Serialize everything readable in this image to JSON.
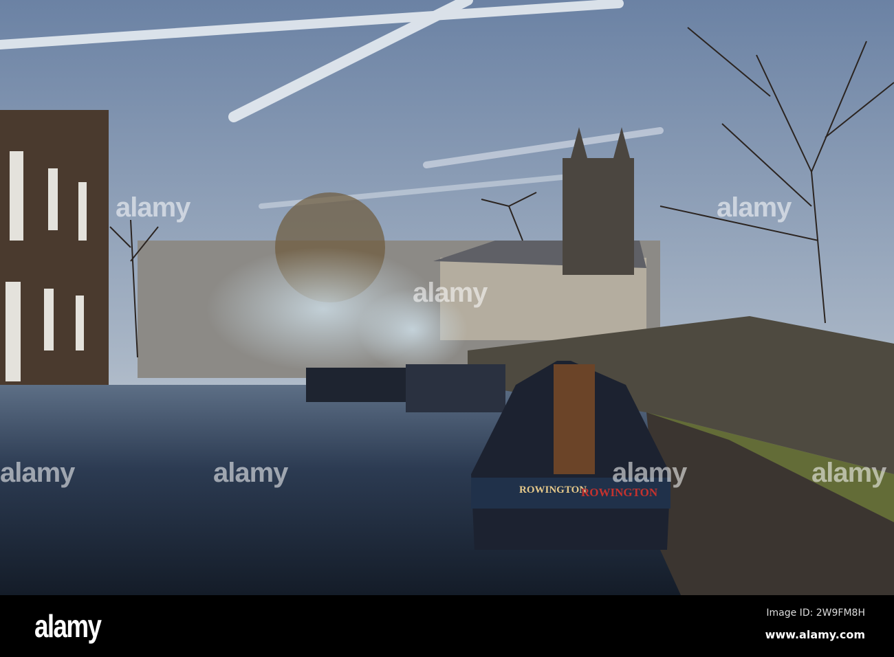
{
  "photo": {
    "subject": "Canal with narrowboats and church tower",
    "boat_name_left": "ROWINGTON",
    "boat_name_right": "ROWINGTON",
    "colors": {
      "sky_top": "#6f85a6",
      "sky_low": "#d7dde3",
      "water": "#1d2a3c",
      "brick": "#4a3a2e",
      "wall": "#4e4a40"
    }
  },
  "watermarks": [
    "alamy",
    "alamy",
    "alamy",
    "alamy",
    "alamy",
    "alamy",
    "alamy"
  ],
  "footer": {
    "logo": "alamy",
    "image_id": "Image ID: 2W9FM8H",
    "website": "www.alamy.com"
  }
}
